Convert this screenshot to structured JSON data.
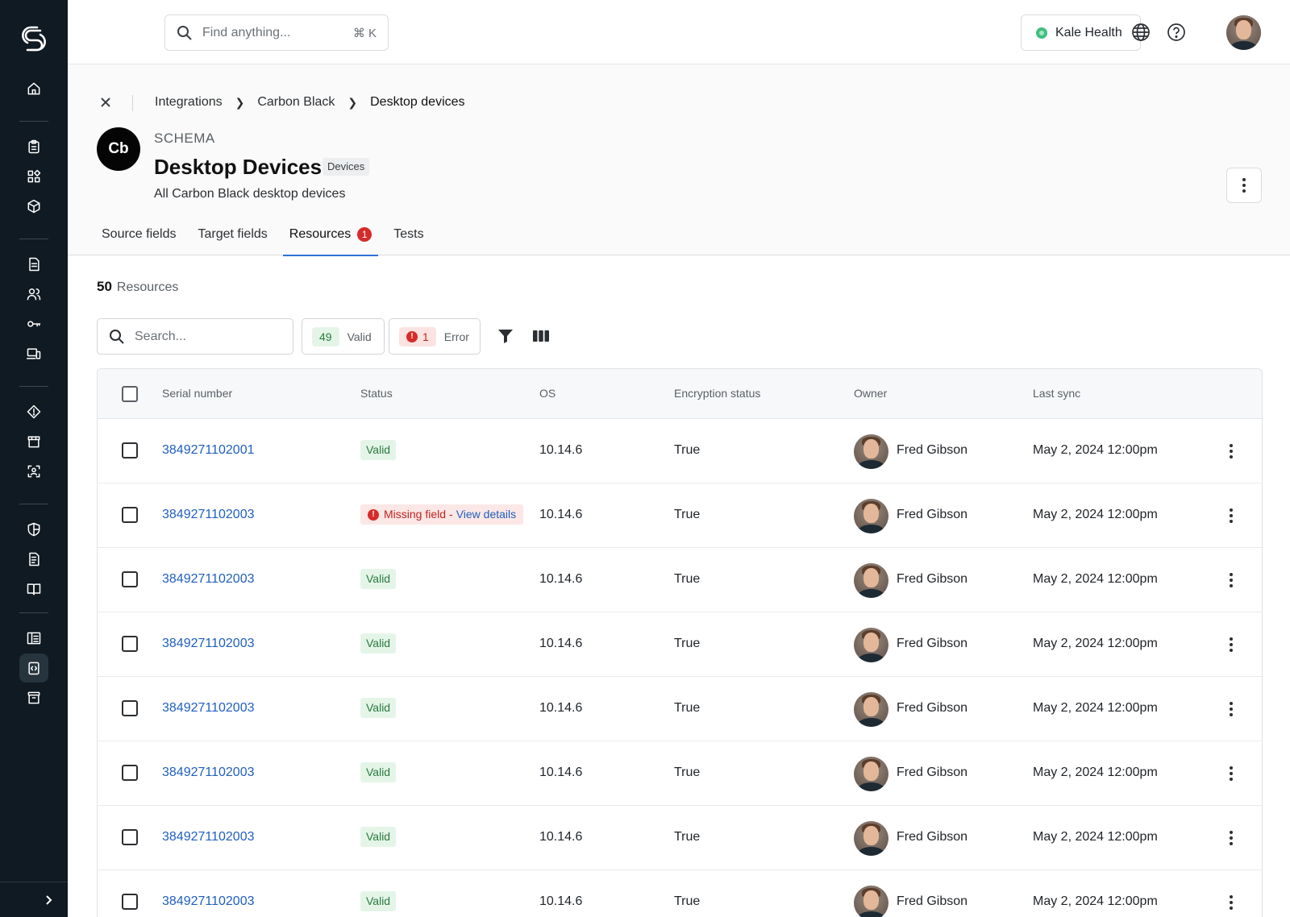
{
  "topbar": {
    "search_placeholder": "Find anything...",
    "search_shortcut": "⌘ K",
    "org_name": "Kale Health"
  },
  "breadcrumb": [
    "Integrations",
    "Carbon Black",
    "Desktop devices"
  ],
  "schema": {
    "logo_text": "Cb",
    "label": "SCHEMA",
    "title": "Desktop Devices",
    "badge": "Devices",
    "description": "All Carbon Black desktop devices"
  },
  "tabs": [
    {
      "label": "Source fields"
    },
    {
      "label": "Target fields"
    },
    {
      "label": "Resources",
      "count": "1",
      "active": true
    },
    {
      "label": "Tests"
    }
  ],
  "resources": {
    "count": "50",
    "count_label": "Resources",
    "search_placeholder": "Search...",
    "valid_count": "49",
    "valid_label": "Valid",
    "error_count": "1",
    "error_label": "Error"
  },
  "table": {
    "columns": [
      "Serial number",
      "Status",
      "OS",
      "Encryption status",
      "Owner",
      "Last sync"
    ],
    "rows": [
      {
        "serial": "3849271102001",
        "status": "Valid",
        "os": "10.14.6",
        "encryption": "True",
        "owner": "Fred Gibson",
        "last_sync": "May 2, 2024 12:00pm"
      },
      {
        "serial": "3849271102003",
        "status": "Missing field",
        "status_link": "View details",
        "status_sep": "-",
        "os": "10.14.6",
        "encryption": "True",
        "owner": "Fred Gibson",
        "last_sync": "May 2, 2024 12:00pm"
      },
      {
        "serial": "3849271102003",
        "status": "Valid",
        "os": "10.14.6",
        "encryption": "True",
        "owner": "Fred Gibson",
        "last_sync": "May 2, 2024 12:00pm"
      },
      {
        "serial": "3849271102003",
        "status": "Valid",
        "os": "10.14.6",
        "encryption": "True",
        "owner": "Fred Gibson",
        "last_sync": "May 2, 2024 12:00pm"
      },
      {
        "serial": "3849271102003",
        "status": "Valid",
        "os": "10.14.6",
        "encryption": "True",
        "owner": "Fred Gibson",
        "last_sync": "May 2, 2024 12:00pm"
      },
      {
        "serial": "3849271102003",
        "status": "Valid",
        "os": "10.14.6",
        "encryption": "True",
        "owner": "Fred Gibson",
        "last_sync": "May 2, 2024 12:00pm"
      },
      {
        "serial": "3849271102003",
        "status": "Valid",
        "os": "10.14.6",
        "encryption": "True",
        "owner": "Fred Gibson",
        "last_sync": "May 2, 2024 12:00pm"
      },
      {
        "serial": "3849271102003",
        "status": "Valid",
        "os": "10.14.6",
        "encryption": "True",
        "owner": "Fred Gibson",
        "last_sync": "May 2, 2024 12:00pm"
      }
    ]
  },
  "colors": {
    "sidebar_bg": "#0f1a22",
    "link_blue": "#1f5fbf",
    "valid_green": "#2a7a3d",
    "error_red": "#d62b2b",
    "tab_underline": "#2f6fd8"
  },
  "icons": {
    "sidebar": [
      "home-icon",
      "clipboard-icon",
      "apps-icon",
      "box-icon",
      "document-icon",
      "users-icon",
      "key-icon",
      "devices-icon",
      "tag-icon",
      "store-icon",
      "scan-icon",
      "shield-icon",
      "policy-icon",
      "book-icon",
      "list-icon",
      "code-icon",
      "archive-icon"
    ],
    "topbar": [
      "search-icon",
      "globe-icon",
      "help-icon"
    ]
  }
}
